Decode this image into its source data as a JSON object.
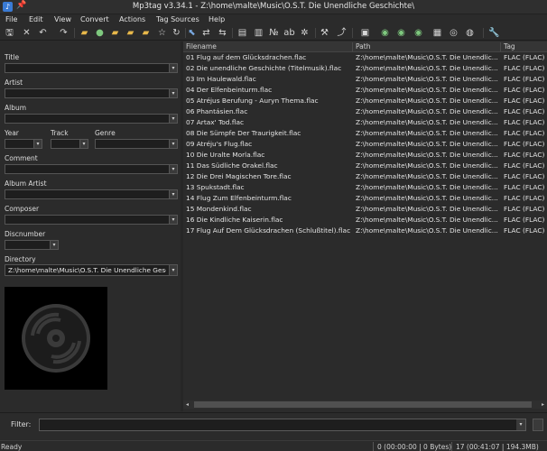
{
  "window": {
    "title": "Mp3tag v3.34.1 - Z:\\home\\malte\\Music\\O.S.T. Die Unendliche Geschichte\\"
  },
  "menu": [
    "File",
    "Edit",
    "View",
    "Convert",
    "Actions",
    "Tag Sources",
    "Help"
  ],
  "fields": {
    "title_label": "Title",
    "artist_label": "Artist",
    "album_label": "Album",
    "year_label": "Year",
    "track_label": "Track",
    "genre_label": "Genre",
    "comment_label": "Comment",
    "album_artist_label": "Album Artist",
    "composer_label": "Composer",
    "discnumber_label": "Discnumber",
    "directory_label": "Directory",
    "directory_value": "Z:\\home\\malte\\Music\\O.S.T. Die Unendliche Gesc"
  },
  "list": {
    "columns": [
      "Filename",
      "Path",
      "Tag"
    ],
    "path_value": "Z:\\home\\malte\\Music\\O.S.T. Die Unendlic...",
    "tag_value": "FLAC (FLAC)",
    "files": [
      "01 Flug auf dem Glücksdrachen.flac",
      "02 Die unendliche Geschichte (Titelmusik).flac",
      "03 Im Haulewald.flac",
      "04 Der Elfenbeinturm.flac",
      "05 Atréjus Berufung - Auryn Thema.flac",
      "06 Phantásien.flac",
      "07 Artax' Tod.flac",
      "08 Die Sümpfe Der Traurigkeit.flac",
      "09 Atréju's Flug.flac",
      "10 Die Uralte Morla.flac",
      "11 Das Südliche Orakel.flac",
      "12 Die Drei Magischen Tore.flac",
      "13 Spukstadt.flac",
      "14 Flug Zum Elfenbeinturm.flac",
      "15 Mondenkind.flac",
      "16 Die Kindliche Kaiserin.flac",
      "17 Flug Auf Dem Glücksdrachen (Schlußtitel).flac"
    ]
  },
  "filter": {
    "label": "Filter:",
    "value": ""
  },
  "status": {
    "ready": "Ready",
    "selected": "0 (00:00:00 | 0 Bytes)",
    "total": "17 (00:41:07 | 194.3MB)"
  },
  "toolbar_icons": [
    "save-icon",
    "undo-delete-icon",
    "undo-icon",
    "redo-icon",
    "open-folder-icon",
    "add-folder-icon",
    "folder-refresh-icon",
    "folder-up-icon",
    "folder-star-icon",
    "favorite-star-icon",
    "refresh-icon",
    "select-icon",
    "tag-filename-icon",
    "filename-tag-icon",
    "text-tag-icon",
    "tag-tag-icon",
    "autonumber-icon",
    "case-convert-icon",
    "magic-icon",
    "wand-icon",
    "export-icon",
    "playlist-icon",
    "tag-source-icon",
    "tag-source-2-icon",
    "cover-icon",
    "web-icon",
    "globe-icon",
    "options-icon"
  ],
  "colors": {
    "background": "#2b2b2b",
    "field": "#1e1e1e",
    "folder": "#e8b84a"
  }
}
